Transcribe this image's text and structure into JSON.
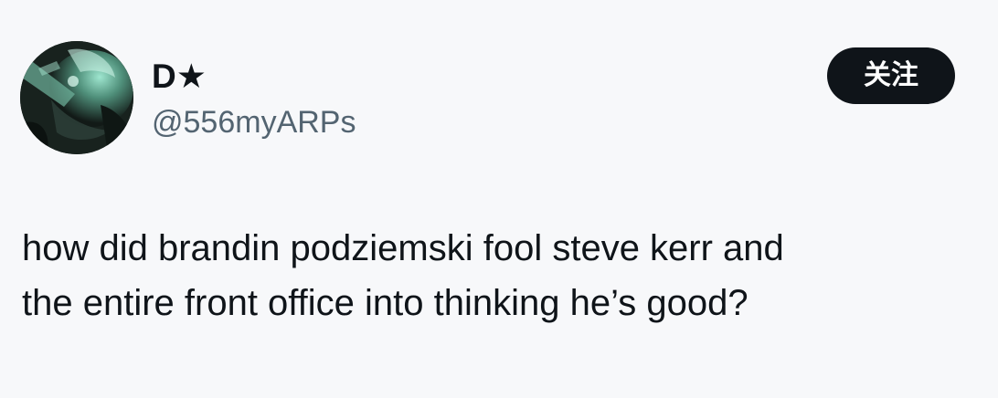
{
  "author": {
    "display_name": "D★",
    "handle": "@556myARPs",
    "avatar_icon": "profile-photo"
  },
  "follow_button": {
    "label": "关注",
    "background": "#0f1419",
    "color": "#ffffff"
  },
  "tweet": {
    "lines": [
      "how did brandin podziemski fool steve kerr and",
      "the entire front office into thinking he’s good?"
    ]
  },
  "colors": {
    "background": "#f7f8fa",
    "text": "#0f1419",
    "secondary_text": "#536471"
  }
}
